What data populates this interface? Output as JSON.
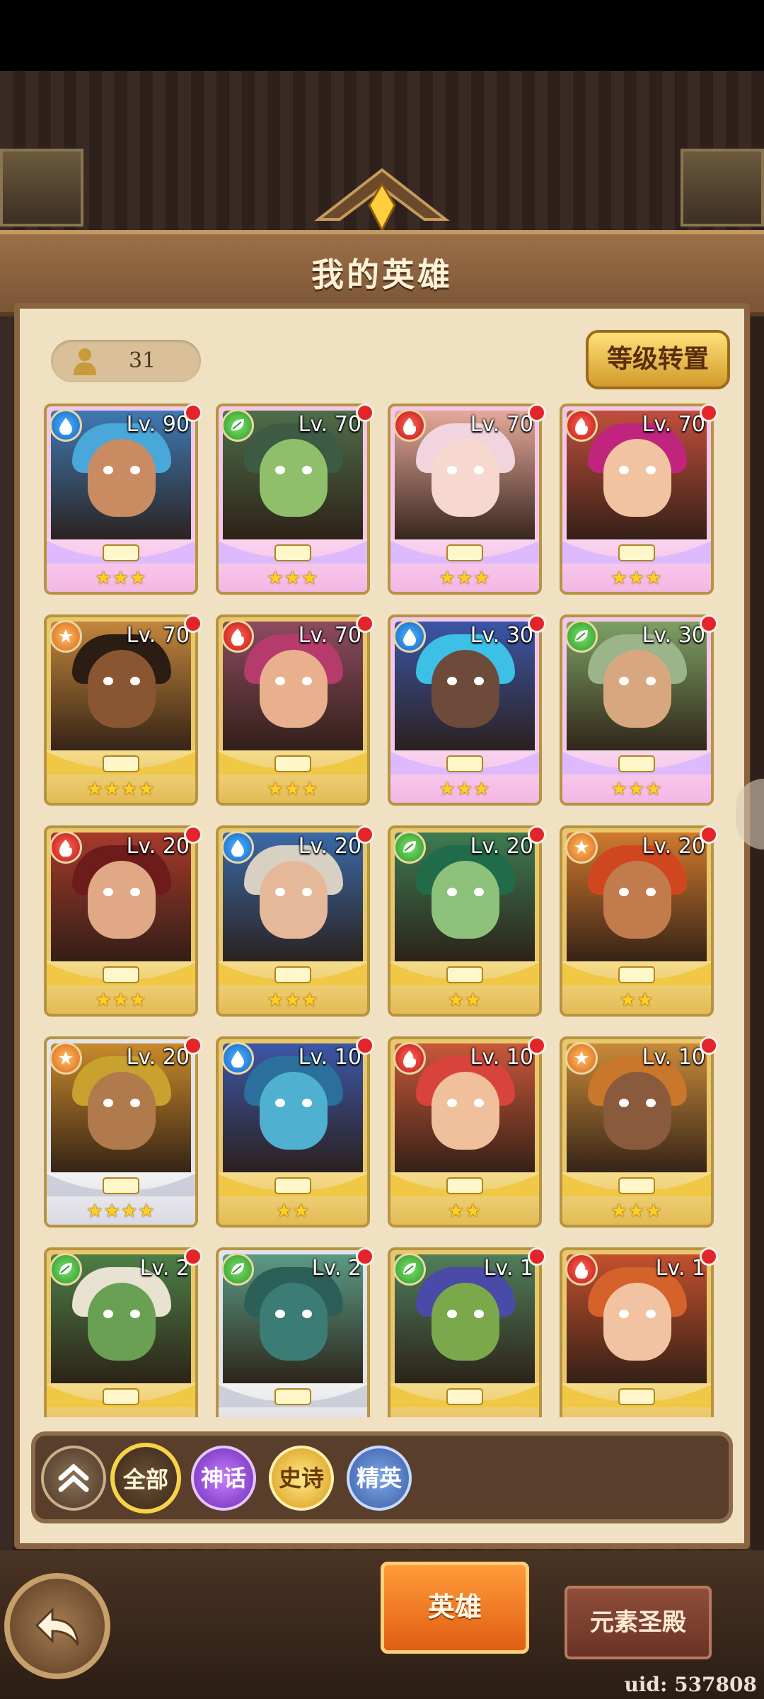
{
  "header": {
    "title": "我的英雄"
  },
  "hero_count": "31",
  "rank_transfer_button": "等级转置",
  "heroes": [
    {
      "level": "Lv. 90",
      "element": "water",
      "stars": "★★★",
      "tier": "pink",
      "skin": "#c98b62",
      "hair": "#4aa7d9",
      "bg": "#3f79b4"
    },
    {
      "level": "Lv. 70",
      "element": "nature",
      "stars": "★★★",
      "tier": "pink",
      "skin": "#8fbf6b",
      "hair": "#3d5a45",
      "bg": "#4f6d49"
    },
    {
      "level": "Lv. 70",
      "element": "fire",
      "stars": "★★★",
      "tier": "pink",
      "skin": "#f6d8cf",
      "hair": "#f2d4df",
      "bg": "#e6a99a"
    },
    {
      "level": "Lv. 70",
      "element": "fire",
      "stars": "★★★",
      "tier": "pink",
      "skin": "#f1c3a0",
      "hair": "#c0247c",
      "bg": "#c04f3c"
    },
    {
      "level": "Lv. 70",
      "element": "light",
      "stars": "★★★★",
      "tier": "gold",
      "skin": "#8a5632",
      "hair": "#2b1d14",
      "bg": "#c3863c"
    },
    {
      "level": "Lv. 70",
      "element": "fire",
      "stars": "★★★",
      "tier": "gold",
      "skin": "#e9b08e",
      "hair": "#b53b6d",
      "bg": "#8d4b5f"
    },
    {
      "level": "Lv. 30",
      "element": "water",
      "stars": "★★★",
      "tier": "pink",
      "skin": "#6e4a3a",
      "hair": "#3cc0e6",
      "bg": "#3b56a7"
    },
    {
      "level": "Lv. 30",
      "element": "nature",
      "stars": "★★★",
      "tier": "pink",
      "skin": "#d9a77f",
      "hair": "#9bb48a",
      "bg": "#7da064"
    },
    {
      "level": "Lv. 20",
      "element": "fire",
      "stars": "★★★",
      "tier": "gold",
      "skin": "#e0a884",
      "hair": "#6e1b1b",
      "bg": "#a63a2c"
    },
    {
      "level": "Lv. 20",
      "element": "water",
      "stars": "★★★",
      "tier": "gold",
      "skin": "#e6b89a",
      "hair": "#d8d0c3",
      "bg": "#3a6aa8"
    },
    {
      "level": "Lv. 20",
      "element": "nature",
      "stars": "★★",
      "tier": "gold",
      "skin": "#8ec27b",
      "hair": "#1f6b4a",
      "bg": "#3e7b52"
    },
    {
      "level": "Lv. 20",
      "element": "light",
      "stars": "★★",
      "tier": "gold",
      "skin": "#c27b4c",
      "hair": "#d0471f",
      "bg": "#d07a2e"
    },
    {
      "level": "Lv. 20",
      "element": "light",
      "stars": "★★★★",
      "tier": "silver",
      "skin": "#b07a4d",
      "hair": "#c9a12e",
      "bg": "#c98a2b"
    },
    {
      "level": "Lv. 10",
      "element": "water",
      "stars": "★★",
      "tier": "gold",
      "skin": "#4fb0d0",
      "hair": "#2b6f9c",
      "bg": "#3c57a8"
    },
    {
      "level": "Lv. 10",
      "element": "fire",
      "stars": "★★",
      "tier": "gold",
      "skin": "#f0c09d",
      "hair": "#d8443b",
      "bg": "#c9583a"
    },
    {
      "level": "Lv. 10",
      "element": "light",
      "stars": "★★★",
      "tier": "gold",
      "skin": "#8a5a3c",
      "hair": "#c9772a",
      "bg": "#c98a3a"
    },
    {
      "level": "Lv. 2",
      "element": "nature",
      "stars": "",
      "tier": "gold",
      "skin": "#6aa054",
      "hair": "#e8e2d0",
      "bg": "#4d7f47"
    },
    {
      "level": "Lv. 2",
      "element": "nature",
      "stars": "",
      "tier": "silver",
      "skin": "#3b7c74",
      "hair": "#2d5f59",
      "bg": "#5b9b84"
    },
    {
      "level": "Lv. 1",
      "element": "nature",
      "stars": "",
      "tier": "gold",
      "skin": "#7aa84a",
      "hair": "#4a4aa8",
      "bg": "#4f7e5b"
    },
    {
      "level": "Lv. 1",
      "element": "fire",
      "stars": "",
      "tier": "gold",
      "skin": "#f2c3a2",
      "hair": "#d4622a",
      "bg": "#c3502f"
    }
  ],
  "filters": {
    "all": "全部",
    "mythic": "神话",
    "epic": "史诗",
    "elite": "精英"
  },
  "tabs": {
    "heroes": "英雄",
    "temple": "元素圣殿"
  },
  "uid": "uid: 537808",
  "colors": {
    "panel": "#efe1c2",
    "accent_orange": "#e15d12",
    "notify_red": "#e3242b"
  }
}
